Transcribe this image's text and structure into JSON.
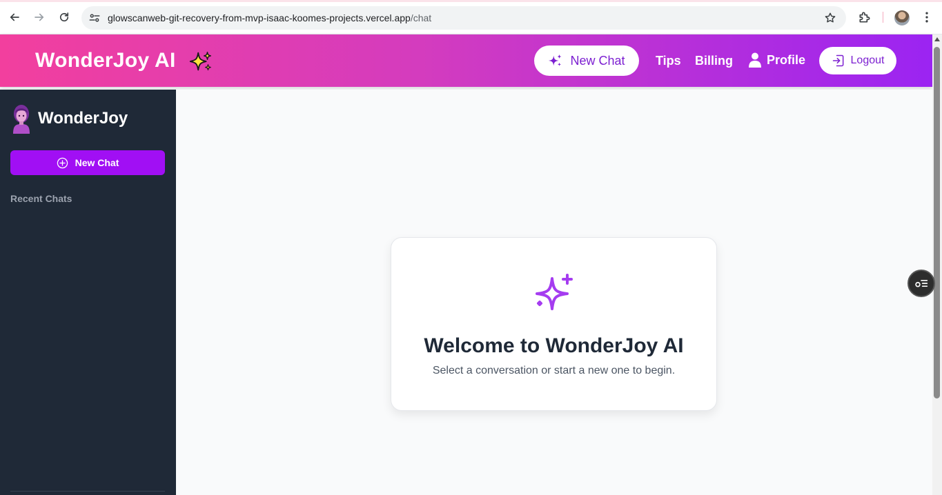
{
  "browser": {
    "url_host": "glowscanweb-git-recovery-from-mvp-isaac-koomes-projects.vercel.app",
    "url_path": "/chat",
    "icons": [
      "back-icon",
      "forward-icon",
      "reload-icon",
      "site-info-icon",
      "bookmark-star-icon",
      "extensions-icon",
      "profile-avatar",
      "menu-dots-icon"
    ]
  },
  "header": {
    "brand": "WonderJoy AI",
    "brand_icon": "sparkles-icon",
    "new_chat_label": "New Chat",
    "tips_label": "Tips",
    "billing_label": "Billing",
    "profile_label": "Profile",
    "logout_label": "Logout",
    "colors": {
      "gradient_start": "#f23f9e",
      "gradient_end": "#9b24f2",
      "accent": "#7c1fd1"
    }
  },
  "sidebar": {
    "title": "WonderJoy",
    "new_chat_label": "New Chat",
    "recent_heading": "Recent Chats",
    "colors": {
      "background": "#1f2937",
      "button": "#a10ff4"
    }
  },
  "main": {
    "welcome_title": "Welcome to WonderJoy AI",
    "welcome_subtitle": "Select a conversation or start a new one to begin.",
    "icon": "sparkles-icon",
    "colors": {
      "icon": "#a53cf0",
      "title": "#1f2937"
    }
  }
}
